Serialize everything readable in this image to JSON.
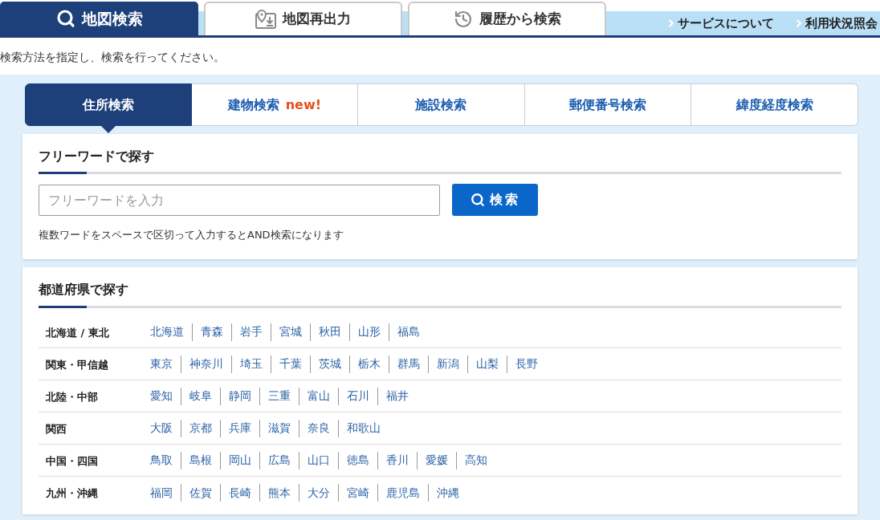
{
  "header_tabs": [
    {
      "label": "地図検索",
      "selected": true
    },
    {
      "label": "地図再出力",
      "selected": false
    },
    {
      "label": "履歴から検索",
      "selected": false
    }
  ],
  "header_links": [
    "サービスについて",
    "利用状況照会"
  ],
  "instruction": "検索方法を指定し、検索を行ってください。",
  "search_tabs": [
    {
      "label": "住所検索",
      "selected": true
    },
    {
      "label": "建物検索",
      "badge": "new!",
      "selected": false
    },
    {
      "label": "施設検索",
      "selected": false
    },
    {
      "label": "郵便番号検索",
      "selected": false
    },
    {
      "label": "緯度経度検索",
      "selected": false
    }
  ],
  "free_word": {
    "title": "フリーワードで探す",
    "placeholder": "フリーワードを入力",
    "button": "検索",
    "hint": "複数ワードをスペースで区切って入力するとAND検索になります"
  },
  "prefectures": {
    "title": "都道府県で探す",
    "regions": [
      {
        "name": "北海道 / 東北",
        "items": [
          "北海道",
          "青森",
          "岩手",
          "宮城",
          "秋田",
          "山形",
          "福島"
        ]
      },
      {
        "name": "関東・甲信越",
        "items": [
          "東京",
          "神奈川",
          "埼玉",
          "千葉",
          "茨城",
          "栃木",
          "群馬",
          "新潟",
          "山梨",
          "長野"
        ]
      },
      {
        "name": "北陸・中部",
        "items": [
          "愛知",
          "岐阜",
          "静岡",
          "三重",
          "富山",
          "石川",
          "福井"
        ]
      },
      {
        "name": "関西",
        "items": [
          "大阪",
          "京都",
          "兵庫",
          "滋賀",
          "奈良",
          "和歌山"
        ]
      },
      {
        "name": "中国・四国",
        "items": [
          "鳥取",
          "島根",
          "岡山",
          "広島",
          "山口",
          "徳島",
          "香川",
          "愛媛",
          "高知"
        ]
      },
      {
        "name": "九州・沖縄",
        "items": [
          "福岡",
          "佐賀",
          "長崎",
          "熊本",
          "大分",
          "宮崎",
          "鹿児島",
          "沖縄"
        ]
      }
    ]
  }
}
